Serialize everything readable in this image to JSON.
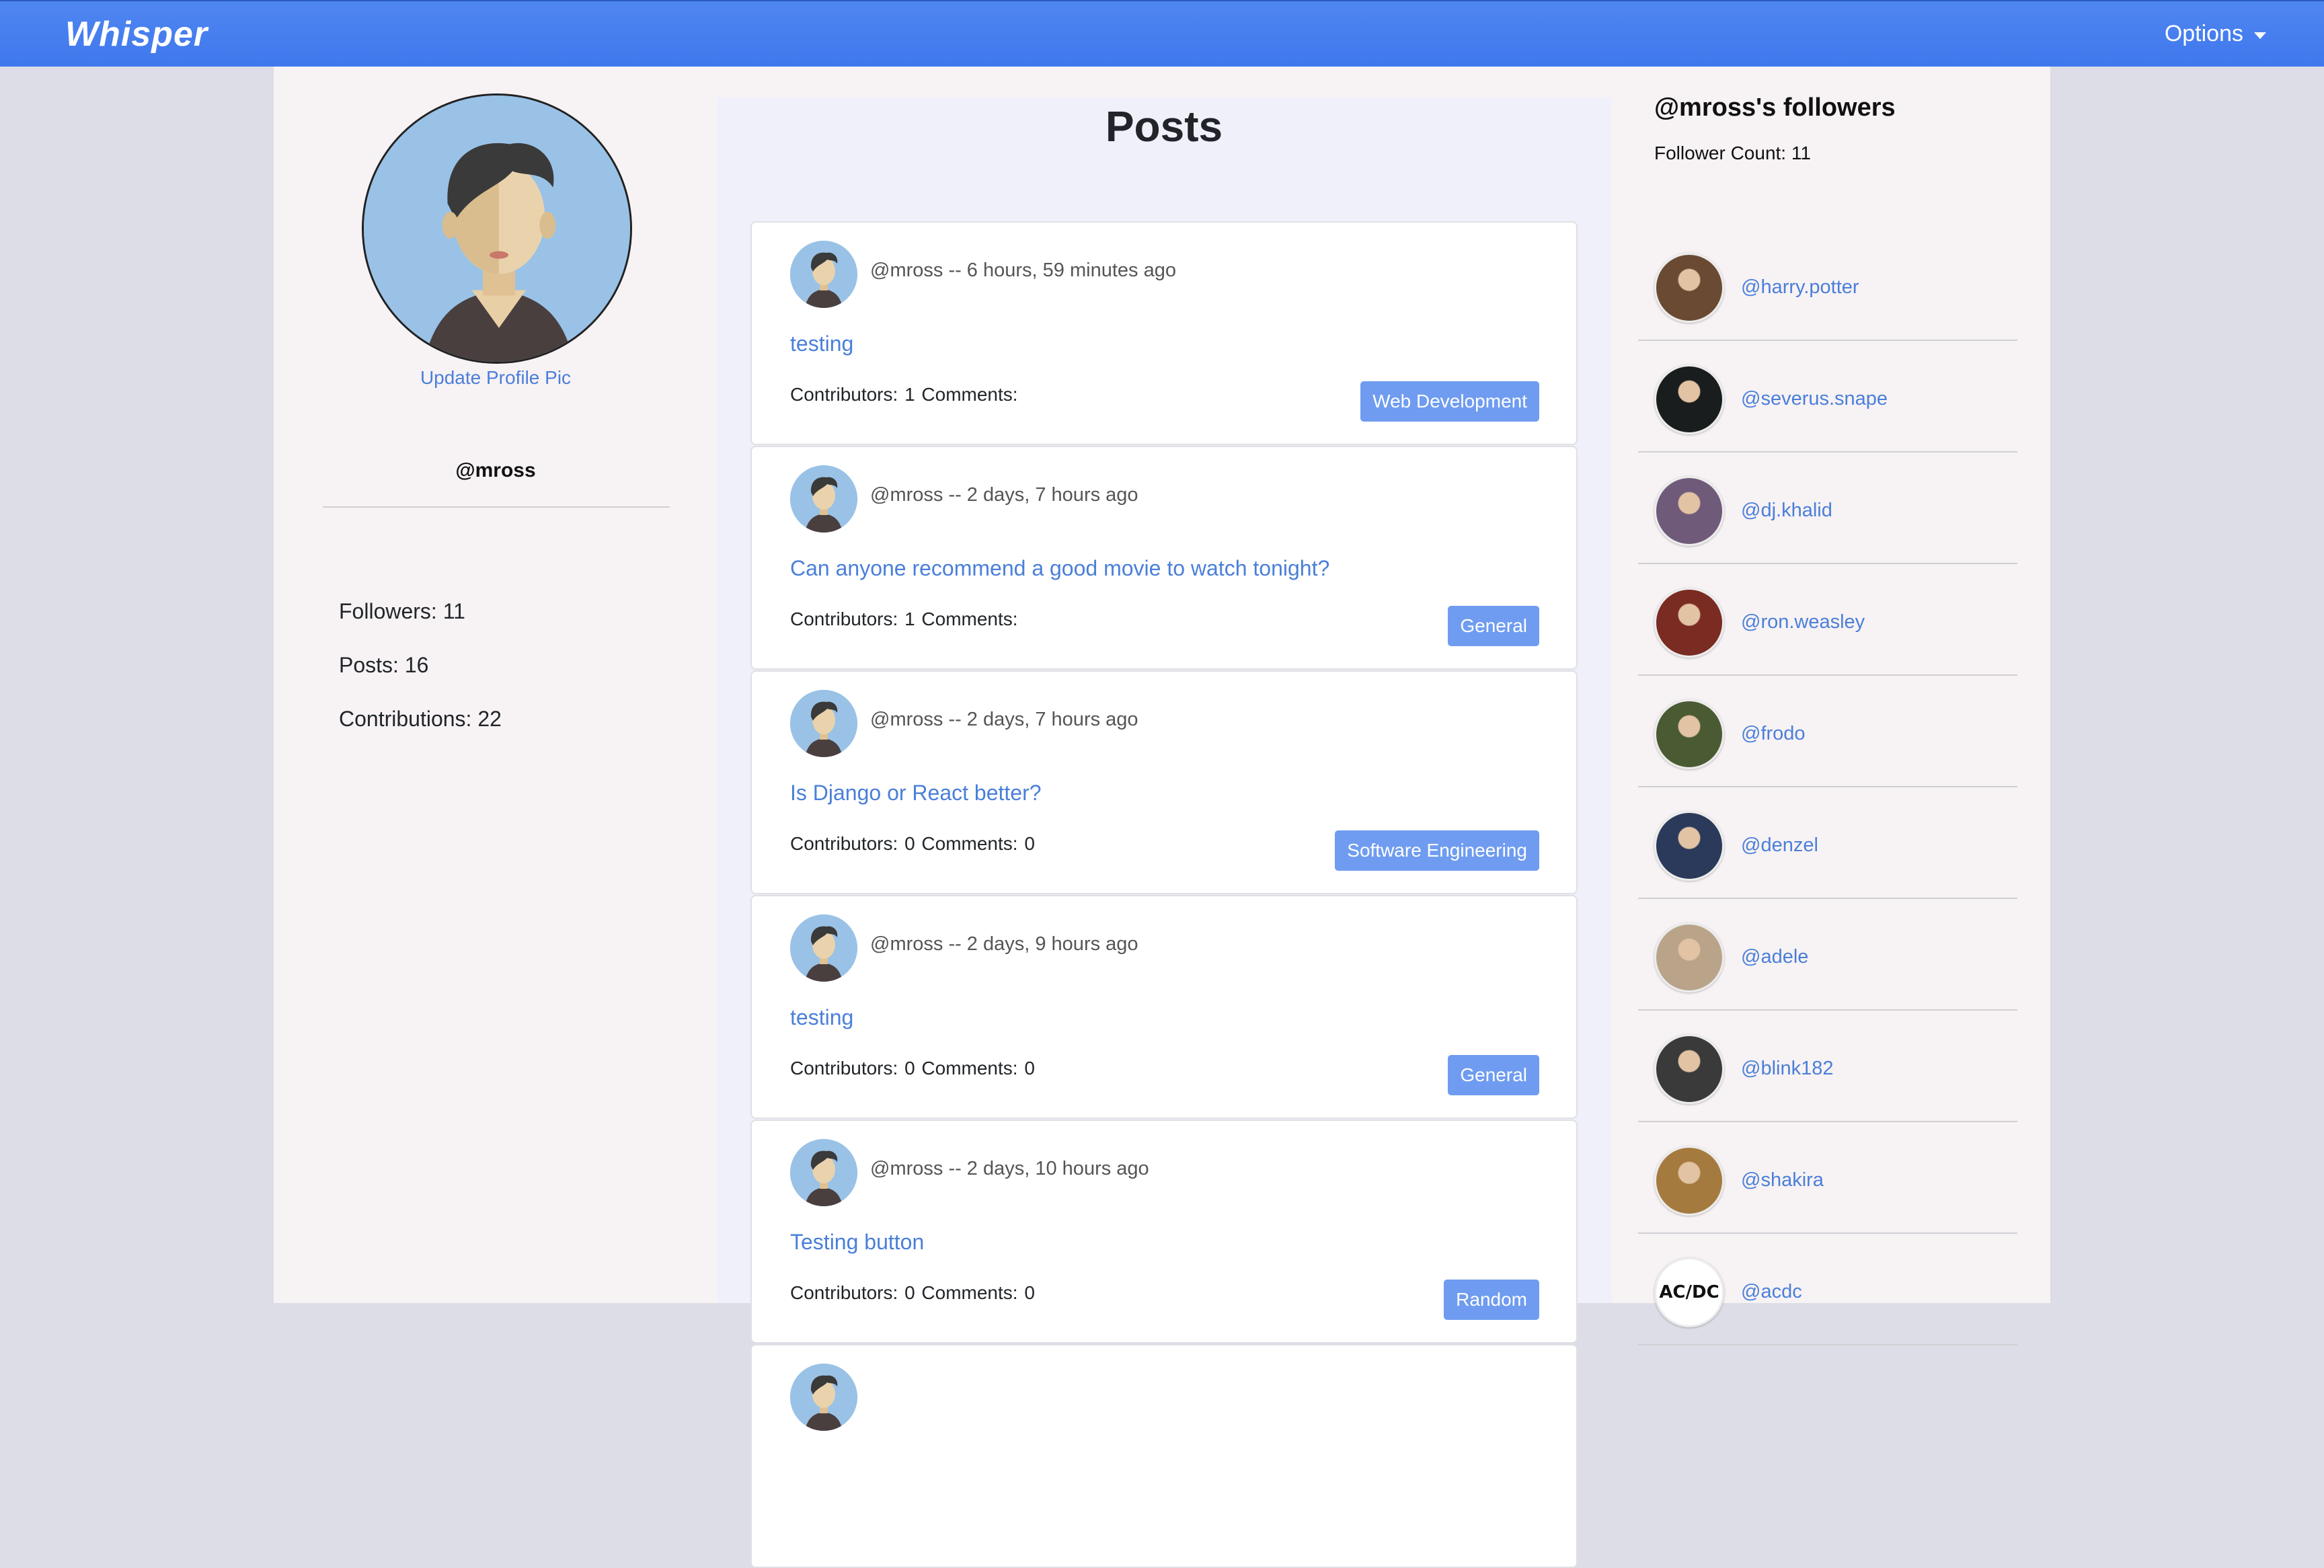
{
  "navbar": {
    "brand": "Whisper",
    "options_label": "Options"
  },
  "profile": {
    "update_pic_label": "Update Profile Pic",
    "username": "@mross",
    "followers": "Followers: 11",
    "posts": "Posts: 16",
    "contributions": "Contributions: 22"
  },
  "posts": {
    "title": "Posts",
    "items": [
      {
        "meta": "@mross -- 6 hours, 59 minutes ago",
        "title": "testing",
        "stats": "Contributors: 1  Comments:",
        "tag": "Web Development"
      },
      {
        "meta": "@mross -- 2 days, 7 hours ago",
        "title": "Can anyone recommend a good movie to watch tonight?",
        "stats": "Contributors: 1  Comments:",
        "tag": "General"
      },
      {
        "meta": "@mross -- 2 days, 7 hours ago",
        "title": "Is Django or React better?",
        "stats": "Contributors: 0  Comments: 0",
        "tag": "Software Engineering"
      },
      {
        "meta": "@mross -- 2 days, 9 hours ago",
        "title": "testing",
        "stats": "Contributors: 0  Comments: 0",
        "tag": "General"
      },
      {
        "meta": "@mross -- 2 days, 10 hours ago",
        "title": "Testing button",
        "stats": "Contributors: 0  Comments: 0",
        "tag": "Random"
      }
    ]
  },
  "followers": {
    "title": "@mross's followers",
    "count_label": "Follower Count: 11",
    "items": [
      {
        "name": "@harry.potter",
        "color": "#6b4a33"
      },
      {
        "name": "@severus.snape",
        "color": "#1a1d1e"
      },
      {
        "name": "@dj.khalid",
        "color": "#6f5a7a"
      },
      {
        "name": "@ron.weasley",
        "color": "#7a2b22"
      },
      {
        "name": "@frodo",
        "color": "#4a5a32"
      },
      {
        "name": "@denzel",
        "color": "#2b3a5a"
      },
      {
        "name": "@adele",
        "color": "#b9a48a"
      },
      {
        "name": "@blink182",
        "color": "#3a3a3a"
      },
      {
        "name": "@shakira",
        "color": "#a57a3e"
      },
      {
        "name": "@acdc",
        "color": "#ffffff",
        "logo_text": "AC/DC"
      }
    ]
  },
  "colors": {
    "navbar": "#4f86f0",
    "link": "#4a7fd9",
    "tag": "#6f9cf0",
    "avatar_bg": "#99c2e6"
  }
}
